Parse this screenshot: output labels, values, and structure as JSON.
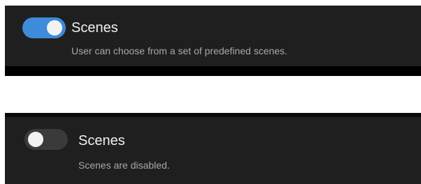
{
  "scenes_enabled": {
    "toggle_state": "on",
    "title": "Scenes",
    "description": "User can choose from a set of predefined scenes.",
    "accent_color": "#3d8bd9"
  },
  "scenes_disabled": {
    "toggle_state": "off",
    "title": "Scenes",
    "description": "Scenes are disabled.",
    "track_color": "#3a3a3a"
  }
}
